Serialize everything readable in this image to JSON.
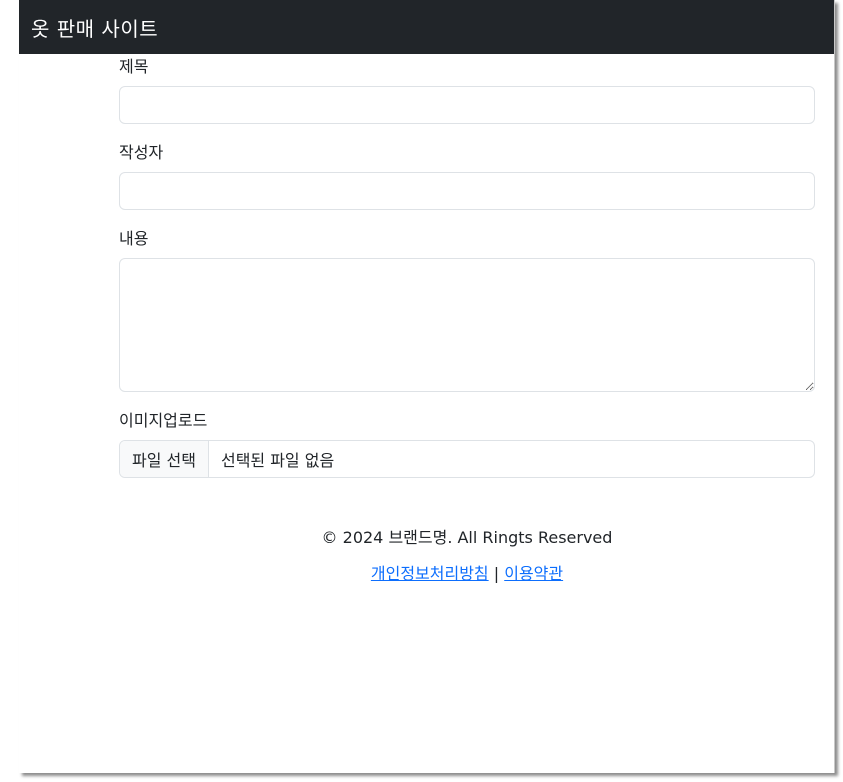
{
  "navbar": {
    "brand": "옷 판매 사이트"
  },
  "form": {
    "title_label": "제목",
    "title_value": "",
    "author_label": "작성자",
    "author_value": "",
    "content_label": "내용",
    "content_value": "",
    "image_label": "이미지업로드",
    "file_button_label": "파일 선택",
    "file_status": "선택된 파일 없음"
  },
  "footer": {
    "copyright": "© 2024 브랜드명. All Ringts Reserved",
    "privacy_link": "개인정보처리방침",
    "separator": "|",
    "terms_link": "이용약관"
  },
  "colors": {
    "navbar_bg": "#212529",
    "link": "#0d6efd",
    "border": "#dee2e6"
  }
}
